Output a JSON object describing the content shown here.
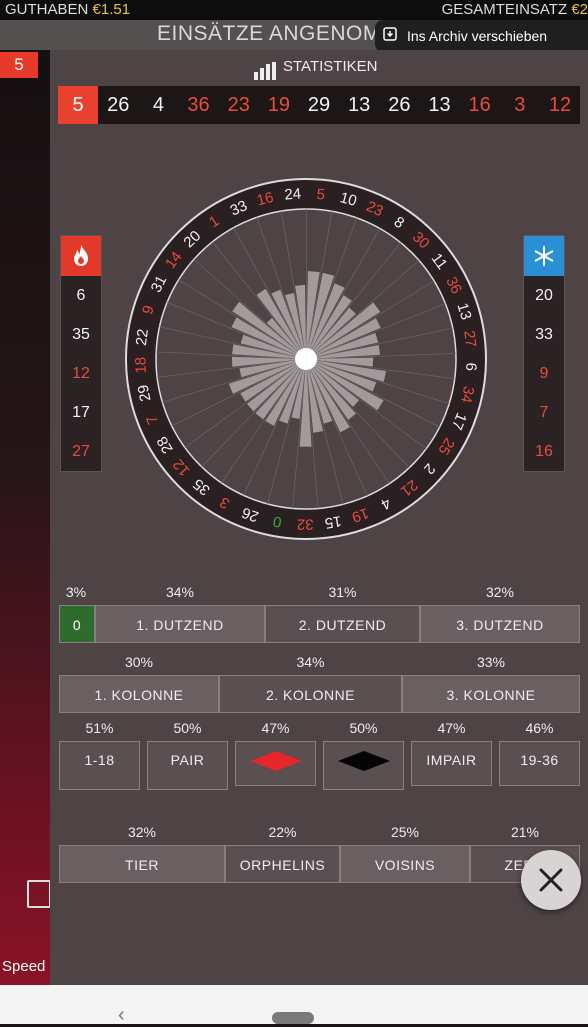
{
  "top_bar": {
    "balance_label": "GUTHABEN",
    "balance_value": "€1.51",
    "total_bet_label": "GESAMTEINSATZ",
    "total_bet_value": "€2"
  },
  "banner": {
    "title": "EINSÄTZE ANGENOM"
  },
  "toast": {
    "text": "Ins Archiv verschieben"
  },
  "left_chip": "5",
  "bottom_left_label": "Speed",
  "stats": {
    "title": "STATISTIKEN"
  },
  "history": [
    {
      "n": "5",
      "c": "red"
    },
    {
      "n": "26",
      "c": "white"
    },
    {
      "n": "4",
      "c": "white"
    },
    {
      "n": "36",
      "c": "red"
    },
    {
      "n": "23",
      "c": "red"
    },
    {
      "n": "19",
      "c": "red"
    },
    {
      "n": "29",
      "c": "white"
    },
    {
      "n": "13",
      "c": "white"
    },
    {
      "n": "26",
      "c": "white"
    },
    {
      "n": "13",
      "c": "white"
    },
    {
      "n": "16",
      "c": "red"
    },
    {
      "n": "3",
      "c": "red"
    },
    {
      "n": "12",
      "c": "red"
    }
  ],
  "hot_numbers": [
    {
      "n": "6",
      "c": "white"
    },
    {
      "n": "35",
      "c": "white"
    },
    {
      "n": "12",
      "c": "red"
    },
    {
      "n": "17",
      "c": "white"
    },
    {
      "n": "27",
      "c": "red"
    }
  ],
  "cold_numbers": [
    {
      "n": "20",
      "c": "white"
    },
    {
      "n": "33",
      "c": "white"
    },
    {
      "n": "9",
      "c": "red"
    },
    {
      "n": "7",
      "c": "red"
    },
    {
      "n": "16",
      "c": "red"
    }
  ],
  "wheel_numbers": [
    {
      "n": "0",
      "c": "green"
    },
    {
      "n": "32",
      "c": "red"
    },
    {
      "n": "15",
      "c": "white"
    },
    {
      "n": "19",
      "c": "red"
    },
    {
      "n": "4",
      "c": "white"
    },
    {
      "n": "21",
      "c": "red"
    },
    {
      "n": "2",
      "c": "white"
    },
    {
      "n": "25",
      "c": "red"
    },
    {
      "n": "17",
      "c": "white"
    },
    {
      "n": "34",
      "c": "red"
    },
    {
      "n": "6",
      "c": "white"
    },
    {
      "n": "27",
      "c": "red"
    },
    {
      "n": "13",
      "c": "white"
    },
    {
      "n": "36",
      "c": "red"
    },
    {
      "n": "11",
      "c": "white"
    },
    {
      "n": "30",
      "c": "red"
    },
    {
      "n": "8",
      "c": "white"
    },
    {
      "n": "23",
      "c": "red"
    },
    {
      "n": "10",
      "c": "white"
    },
    {
      "n": "5",
      "c": "red"
    },
    {
      "n": "24",
      "c": "white"
    },
    {
      "n": "16",
      "c": "red"
    },
    {
      "n": "33",
      "c": "white"
    },
    {
      "n": "1",
      "c": "red"
    },
    {
      "n": "20",
      "c": "white"
    },
    {
      "n": "14",
      "c": "red"
    },
    {
      "n": "31",
      "c": "white"
    },
    {
      "n": "9",
      "c": "red"
    },
    {
      "n": "22",
      "c": "white"
    },
    {
      "n": "18",
      "c": "red"
    },
    {
      "n": "29",
      "c": "white"
    },
    {
      "n": "7",
      "c": "red"
    },
    {
      "n": "28",
      "c": "white"
    },
    {
      "n": "12",
      "c": "red"
    },
    {
      "n": "35",
      "c": "white"
    },
    {
      "n": "3",
      "c": "red"
    },
    {
      "n": "26",
      "c": "white"
    }
  ],
  "wheel_bars": [
    0.35,
    0.55,
    0.45,
    0.4,
    0.5,
    0.45,
    0.4,
    0.55,
    0.45,
    0.5,
    0.4,
    0.45,
    0.45,
    0.5,
    0.55,
    0.4,
    0.45,
    0.5,
    0.55,
    0.55,
    0.45,
    0.4,
    0.45,
    0.5,
    0.3,
    0.55,
    0.5,
    0.4,
    0.45,
    0.45,
    0.4,
    0.5,
    0.45,
    0.45,
    0.45,
    0.45,
    0.4
  ],
  "wheel_bar_status": [
    "n",
    "n",
    "n",
    "n",
    "n",
    "n",
    "n",
    "n",
    "n",
    "n",
    "n",
    "n",
    "n",
    "n",
    "n",
    "n",
    "n",
    "n",
    "n",
    "n",
    "n",
    "n",
    "n",
    "n",
    "n",
    "n",
    "n",
    "n",
    "n",
    "n",
    "n",
    "n",
    "n",
    "n",
    "n",
    "n",
    "n"
  ],
  "dozens": {
    "zero": {
      "label": "0",
      "pct": "3%"
    },
    "items": [
      {
        "label": "1. DUTZEND",
        "pct": "34%"
      },
      {
        "label": "2. DUTZEND",
        "pct": "31%"
      },
      {
        "label": "3. DUTZEND",
        "pct": "32%"
      }
    ]
  },
  "columns": [
    {
      "label": "1. KOLONNE",
      "pct": "30%"
    },
    {
      "label": "2. KOLONNE",
      "pct": "34%"
    },
    {
      "label": "3. KOLONNE",
      "pct": "33%"
    }
  ],
  "even_bets": [
    {
      "label": "1-18",
      "pct": "51%"
    },
    {
      "label": "PAIR",
      "pct": "50%"
    },
    {
      "label": "",
      "pct": "47%"
    },
    {
      "label": "",
      "pct": "50%"
    },
    {
      "label": "IMPAIR",
      "pct": "47%"
    },
    {
      "label": "19-36",
      "pct": "46%"
    }
  ],
  "special_bets": [
    {
      "label": "TIER",
      "pct": "32%"
    },
    {
      "label": "ORPHELINS",
      "pct": "22%"
    },
    {
      "label": "VOISINS",
      "pct": "25%"
    },
    {
      "label": "ZERO",
      "pct": "21%"
    }
  ],
  "colors": {
    "red": "#e84c3d",
    "hot": "#e82a2a",
    "cold": "#2b8fd4",
    "bar": "#a29b9c",
    "green": "#3caa3c"
  }
}
